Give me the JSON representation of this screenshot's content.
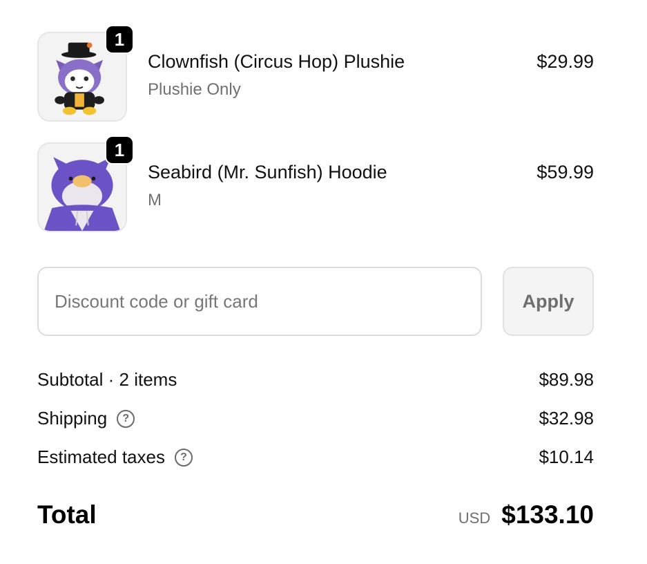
{
  "items": [
    {
      "name": "Clownfish (Circus Hop) Plushie",
      "variant": "Plushie Only",
      "price": "$29.99",
      "quantity": "1",
      "image_icon": "plushie-image"
    },
    {
      "name": "Seabird (Mr. Sunfish) Hoodie",
      "variant": "M",
      "price": "$59.99",
      "quantity": "1",
      "image_icon": "hoodie-image"
    }
  ],
  "discount": {
    "placeholder": "Discount code or gift card",
    "value": "",
    "apply_label": "Apply"
  },
  "summary": {
    "subtotal_label": "Subtotal · 2 items",
    "subtotal_value": "$89.98",
    "shipping_label": "Shipping",
    "shipping_value": "$32.98",
    "taxes_label": "Estimated taxes",
    "taxes_value": "$10.14",
    "help_icon": "question-circle-icon"
  },
  "total": {
    "label": "Total",
    "currency": "USD",
    "amount": "$133.10"
  },
  "colors": {
    "text": "#111111",
    "muted": "#707070",
    "badge": "#000000",
    "hoodie_purple": "#6b53c7",
    "plush_purple": "#8a6fc9"
  }
}
